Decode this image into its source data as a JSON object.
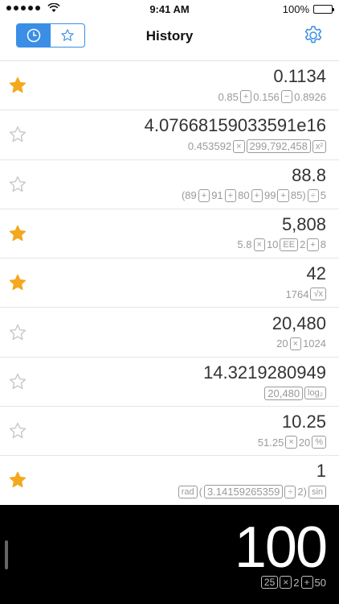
{
  "status_bar": {
    "time": "9:41 AM",
    "battery": "100%",
    "battery_level": 1.0
  },
  "nav": {
    "title": "History",
    "segments": [
      {
        "icon": "clock-icon",
        "active": true
      },
      {
        "icon": "star-icon",
        "active": false
      }
    ]
  },
  "colors": {
    "accent": "#3a8ee6",
    "star_on": "#f4a81d",
    "star_off": "#c8c8c8"
  },
  "history": [
    {
      "starred": true,
      "result": "0.1134",
      "expr": [
        {
          "t": "0.85"
        },
        {
          "b": "+"
        },
        {
          "t": "0.156"
        },
        {
          "b": "−"
        },
        {
          "t": "0.8926"
        }
      ]
    },
    {
      "starred": false,
      "result": "4.07668159033591e16",
      "expr": [
        {
          "t": "0.453592"
        },
        {
          "b": "×"
        },
        {
          "n": "299,792,458"
        },
        {
          "b": "x²"
        }
      ]
    },
    {
      "starred": false,
      "result": "88.8",
      "expr": [
        {
          "t": "(89"
        },
        {
          "b": "+"
        },
        {
          "t": "91"
        },
        {
          "b": "+"
        },
        {
          "t": "80"
        },
        {
          "b": "+"
        },
        {
          "t": "99"
        },
        {
          "b": "+"
        },
        {
          "t": "85)"
        },
        {
          "b": "÷"
        },
        {
          "t": "5"
        }
      ]
    },
    {
      "starred": true,
      "result": "5,808",
      "expr": [
        {
          "t": "5.8"
        },
        {
          "b": "×"
        },
        {
          "t": "10"
        },
        {
          "b": "EE"
        },
        {
          "t": "2"
        },
        {
          "b": "+"
        },
        {
          "t": "8"
        }
      ]
    },
    {
      "starred": true,
      "result": "42",
      "expr": [
        {
          "t": "1764"
        },
        {
          "b": "√x"
        }
      ]
    },
    {
      "starred": false,
      "result": "20,480",
      "expr": [
        {
          "t": "20"
        },
        {
          "b": "×"
        },
        {
          "t": "1024"
        }
      ]
    },
    {
      "starred": false,
      "result": "14.3219280949",
      "expr": [
        {
          "n": "20,480"
        },
        {
          "b": "log₂"
        }
      ]
    },
    {
      "starred": false,
      "result": "10.25",
      "expr": [
        {
          "t": "51.25"
        },
        {
          "b": "×"
        },
        {
          "t": "20"
        },
        {
          "b": "%"
        }
      ]
    },
    {
      "starred": true,
      "result": "1",
      "expr": [
        {
          "b": "rad"
        },
        {
          "t": "("
        },
        {
          "n": "3.14159265359"
        },
        {
          "b": "÷"
        },
        {
          "t": "2)"
        },
        {
          "b": "sin"
        }
      ]
    }
  ],
  "display": {
    "value": "100",
    "expr": [
      {
        "b": "25"
      },
      {
        "b": "×"
      },
      {
        "t": "2"
      },
      {
        "b": "+"
      },
      {
        "t": "50"
      }
    ]
  }
}
